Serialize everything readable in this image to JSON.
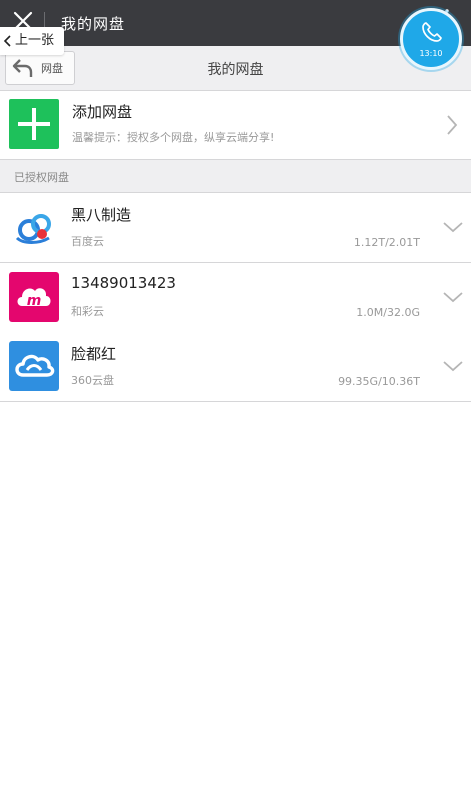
{
  "topbar": {
    "title": "我的网盘",
    "close_icon": "close-icon",
    "more_icon": "more-vertical-icon"
  },
  "prev_tag": {
    "label": "上一张"
  },
  "call": {
    "time": "13:10",
    "icon": "phone-icon"
  },
  "subheader": {
    "back_label": "网盘",
    "title": "我的网盘"
  },
  "add_disk": {
    "title": "添加网盘",
    "hint": "温馨提示：授权多个网盘，纵享云端分享!"
  },
  "section": {
    "title": "已授权网盘"
  },
  "disks": [
    {
      "name": "黑八制造",
      "provider": "百度云",
      "usage": "1.12T/2.01T"
    },
    {
      "name": "13489013423",
      "provider": "和彩云",
      "usage": "1.0M/32.0G"
    },
    {
      "name": "脸都红",
      "provider": "360云盘",
      "usage": "99.35G/10.36T"
    }
  ],
  "colors": {
    "topbar": "#3a3b3f",
    "add_green": "#1ec15b",
    "call_blue": "#1fa8e8",
    "hecaiyun_magenta": "#e4066e",
    "yunpan360_blue": "#2f8fe0"
  }
}
